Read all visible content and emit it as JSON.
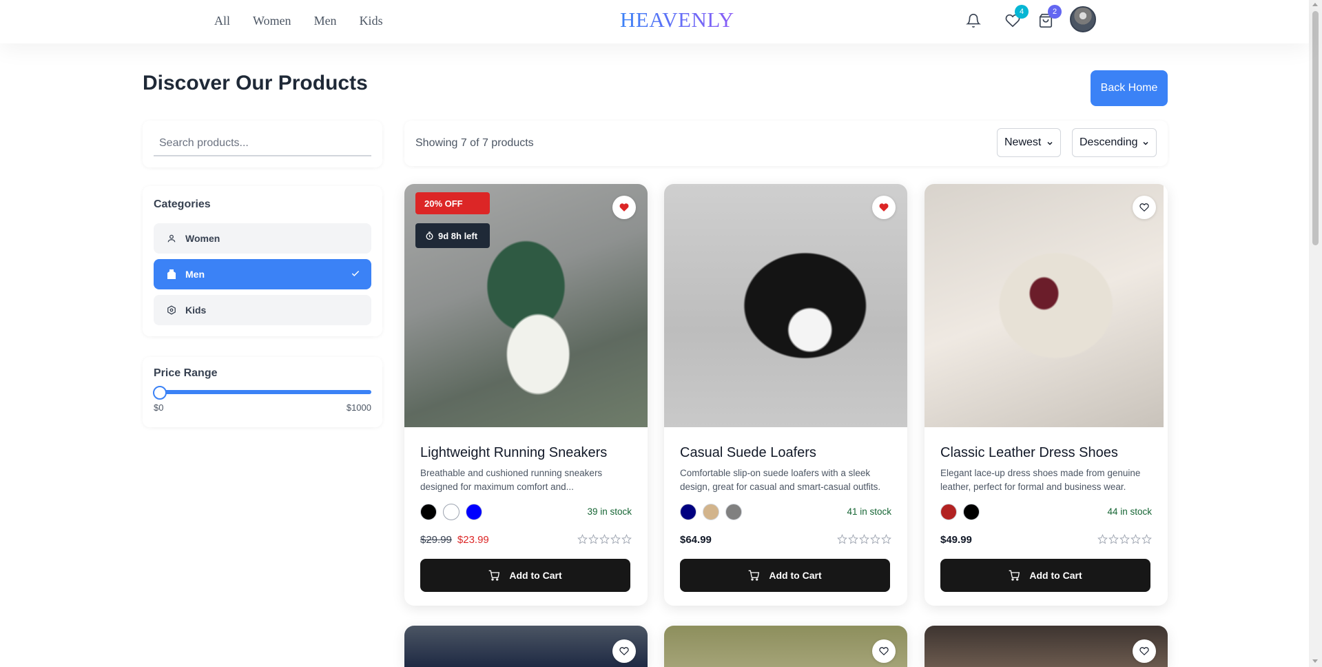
{
  "nav": {
    "links": [
      "All",
      "Women",
      "Men",
      "Kids"
    ],
    "brand": "HEAVENLY",
    "wishlist_count": "4",
    "cart_count": "2"
  },
  "header": {
    "title": "Discover Our Products",
    "back_home_label": "Back Home"
  },
  "search": {
    "placeholder": "Search products..."
  },
  "categories": {
    "title": "Categories",
    "items": [
      {
        "label": "Women",
        "icon": "user-icon"
      },
      {
        "label": "Men",
        "icon": "shirt-icon",
        "selected": true
      },
      {
        "label": "Kids",
        "icon": "hexagon-icon"
      }
    ]
  },
  "price_range": {
    "title": "Price Range",
    "min_label": "$0",
    "max_label": "$1000",
    "level": 0.0
  },
  "toolbar": {
    "showing_text": "Showing 7 of 7 products",
    "sort_value": "Newest",
    "order_value": "Descending"
  },
  "products": [
    {
      "name": "Lightweight Running Sneakers",
      "description": "Breathable and cushioned running sneakers designed for maximum comfort and...",
      "badge": "20% OFF",
      "timer": "9d 8h left",
      "colors": [
        "#000000",
        "#ffffff",
        "#0000ff"
      ],
      "stock": "39 in stock",
      "old_price": "$29.99",
      "price": "$23.99",
      "favorited": true,
      "rating": 0,
      "cta": "Add to Cart"
    },
    {
      "name": "Casual Suede Loafers",
      "description": "Comfortable slip-on suede loafers with a sleek design, great for casual and smart-casual outfits.",
      "colors": [
        "#000080",
        "#d2b48c",
        "#808080"
      ],
      "stock": "41 in stock",
      "price": "$64.99",
      "favorited": true,
      "rating": 0,
      "cta": "Add to Cart"
    },
    {
      "name": "Classic Leather Dress Shoes",
      "description": "Elegant lace-up dress shoes made from genuine leather, perfect for formal and business wear.",
      "colors": [
        "#b22222",
        "#000000"
      ],
      "stock": "44 in stock",
      "price": "$49.99",
      "favorited": false,
      "rating": 0,
      "cta": "Add to Cart"
    }
  ],
  "colors": {
    "accent": "#3b82f6",
    "sale": "#dc2626",
    "dark": "#171717",
    "stock": "#166534"
  }
}
